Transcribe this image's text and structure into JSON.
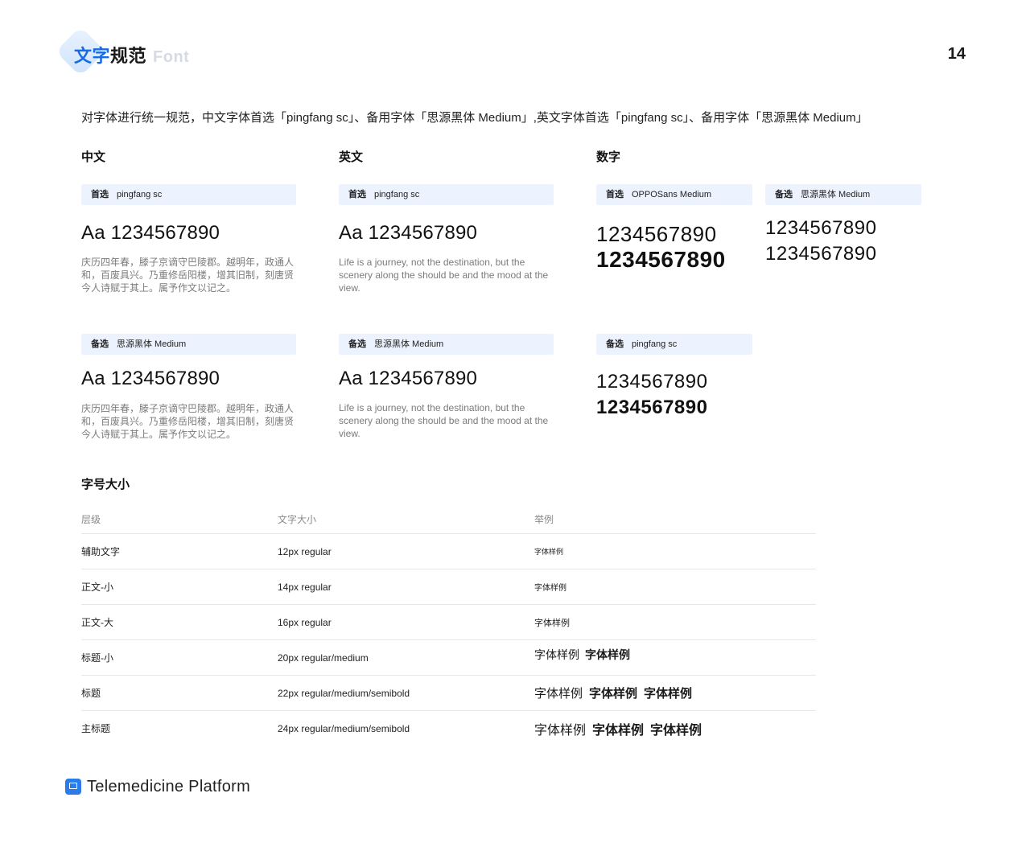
{
  "header": {
    "title_blue": "文字",
    "title_dark": "规范",
    "title_sub": "Font",
    "page_number": "14"
  },
  "intro": "对字体进行统一规范，中文字体首选「pingfang sc」、备用字体「思源黑体 Medium」,英文字体首选「pingfang sc」、备用字体「思源黑体 Medium」",
  "columns": {
    "chinese": {
      "title": "中文",
      "primary": {
        "key": "首选",
        "font": "pingfang sc",
        "sample": "Aa 1234567890",
        "text": "庆历四年春，滕子京谪守巴陵郡。越明年，政通人和，百废具兴。乃重修岳阳楼，增其旧制，刻唐贤今人诗赋于其上。属予作文以记之。"
      },
      "backup": {
        "key": "备选",
        "font": "思源黑体 Medium",
        "sample": "Aa 1234567890",
        "text": "庆历四年春，滕子京谪守巴陵郡。越明年，政通人和，百废具兴。乃重修岳阳楼，增其旧制，刻唐贤今人诗赋于其上。属予作文以记之。"
      }
    },
    "english": {
      "title": "英文",
      "primary": {
        "key": "首选",
        "font": "pingfang sc",
        "sample": "Aa 1234567890",
        "text": "Life is a journey, not the destination, but the scenery along the should be and the mood at the view."
      },
      "backup": {
        "key": "备选",
        "font": "思源黑体 Medium",
        "sample": "Aa 1234567890",
        "text": "Life is a journey, not the destination, but the scenery along the should be and the mood at the view."
      }
    },
    "numbers": {
      "title": "数字",
      "primary": {
        "key": "首选",
        "font": "OPPOSans Medium",
        "regular": "1234567890",
        "bold": "1234567890"
      },
      "alternate": {
        "key": "备选",
        "font": "思源黑体 Medium",
        "regular": "1234567890",
        "bold": "1234567890"
      },
      "backup": {
        "key": "备选",
        "font": "pingfang sc",
        "regular": "1234567890",
        "bold": "1234567890"
      }
    }
  },
  "size_table": {
    "title": "字号大小",
    "headers": [
      "层级",
      "文字大小",
      "举例"
    ],
    "rows": [
      {
        "level": "辅助文字",
        "size": "12px regular",
        "examples": [
          "字体样例"
        ]
      },
      {
        "level": "正文-小",
        "size": "14px regular",
        "examples": [
          "字体样例"
        ]
      },
      {
        "level": "正文-大",
        "size": "16px regular",
        "examples": [
          "字体样例"
        ]
      },
      {
        "level": "标题-小",
        "size": "20px regular/medium",
        "examples": [
          "字体样例",
          "字体样例"
        ]
      },
      {
        "level": "标题",
        "size": "22px regular/medium/semibold",
        "examples": [
          "字体样例",
          "字体样例",
          "字体样例"
        ]
      },
      {
        "level": "主标题",
        "size": "24px regular/medium/semibold",
        "examples": [
          "字体样例",
          "字体样例",
          "字体样例"
        ]
      }
    ]
  },
  "footer": {
    "brand": "Telemedicine Platform",
    "icon": "monitor-icon"
  }
}
